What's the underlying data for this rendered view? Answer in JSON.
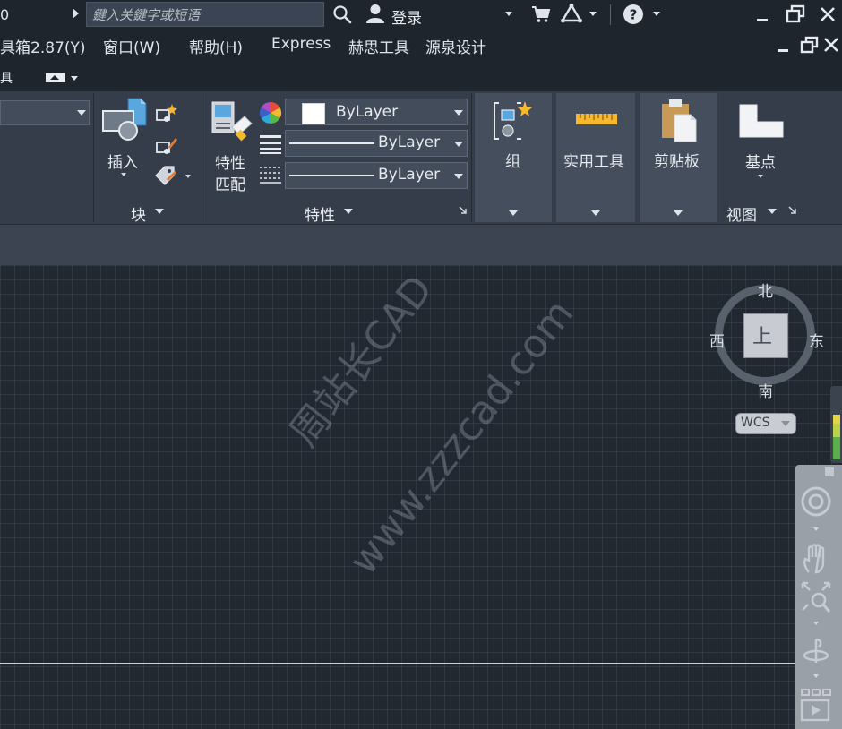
{
  "titlebar": {
    "left_glyph": "0",
    "search_placeholder": "鍵入关鍵字或短语",
    "login_label": "登录"
  },
  "menubar": {
    "items": [
      "具箱2.87(Y)",
      "窗口(W)",
      "帮助(H)",
      "Express",
      "赫思工具",
      "源泉设计"
    ]
  },
  "tabrow": {
    "edge_label": "具"
  },
  "ribbon": {
    "block_panel": {
      "insert_label": "插入",
      "title": "块"
    },
    "properties_panel": {
      "match_label_line1": "特性",
      "match_label_line2": "匹配",
      "color_value": "ByLayer",
      "linetype_value": "ByLayer",
      "lineweight_value": "ByLayer",
      "title": "特性"
    },
    "groups_panel": {
      "label": "组"
    },
    "utilities_panel": {
      "label": "实用工具"
    },
    "clipboard_panel": {
      "label": "剪贴板"
    },
    "view_panel": {
      "basepoint_label": "基点",
      "title": "视图"
    }
  },
  "viewcube": {
    "north": "北",
    "south": "南",
    "east": "东",
    "west": "西",
    "face": "上",
    "wcs_label": "WCS"
  },
  "watermark": {
    "line1": "周站长CAD",
    "line2": "www.zzzcad.com"
  },
  "colors": {
    "background": "#212830",
    "ribbon": "#353d4a",
    "titlebar": "#1f252d"
  }
}
